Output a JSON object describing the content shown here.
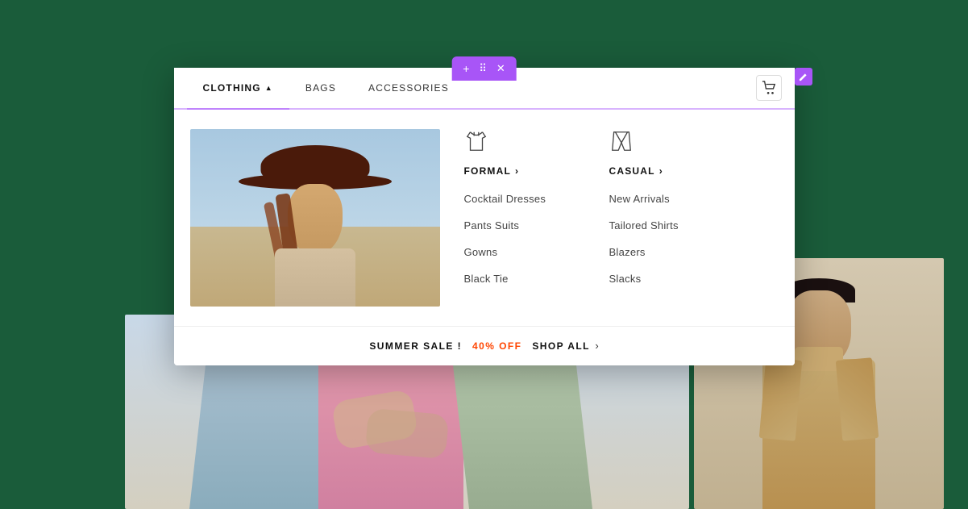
{
  "background": {
    "color": "#1a5c3a"
  },
  "toolbar": {
    "plus_label": "+",
    "grid_label": "⠿",
    "close_label": "✕"
  },
  "nav": {
    "items": [
      {
        "id": "clothing",
        "label": "CLOTHING",
        "active": true,
        "has_arrow": true
      },
      {
        "id": "bags",
        "label": "BAGS",
        "active": false,
        "has_arrow": false
      },
      {
        "id": "accessories",
        "label": "ACCESSORIES",
        "active": false,
        "has_arrow": false
      }
    ],
    "cart_label": "🛒"
  },
  "dropdown": {
    "categories": [
      {
        "id": "formal",
        "icon_name": "shirt-icon",
        "title": "FORMAL",
        "items": [
          "Cocktail Dresses",
          "Pants Suits",
          "Gowns",
          "Black Tie"
        ]
      },
      {
        "id": "casual",
        "icon_name": "pants-icon",
        "title": "CASUAL",
        "items": [
          "New Arrivals",
          "Tailored Shirts",
          "Blazers",
          "Slacks"
        ]
      }
    ]
  },
  "sale_banner": {
    "prefix": "SUMMER SALE !",
    "discount": "40% OFF",
    "cta": "SHOP ALL",
    "chevron": "›"
  }
}
